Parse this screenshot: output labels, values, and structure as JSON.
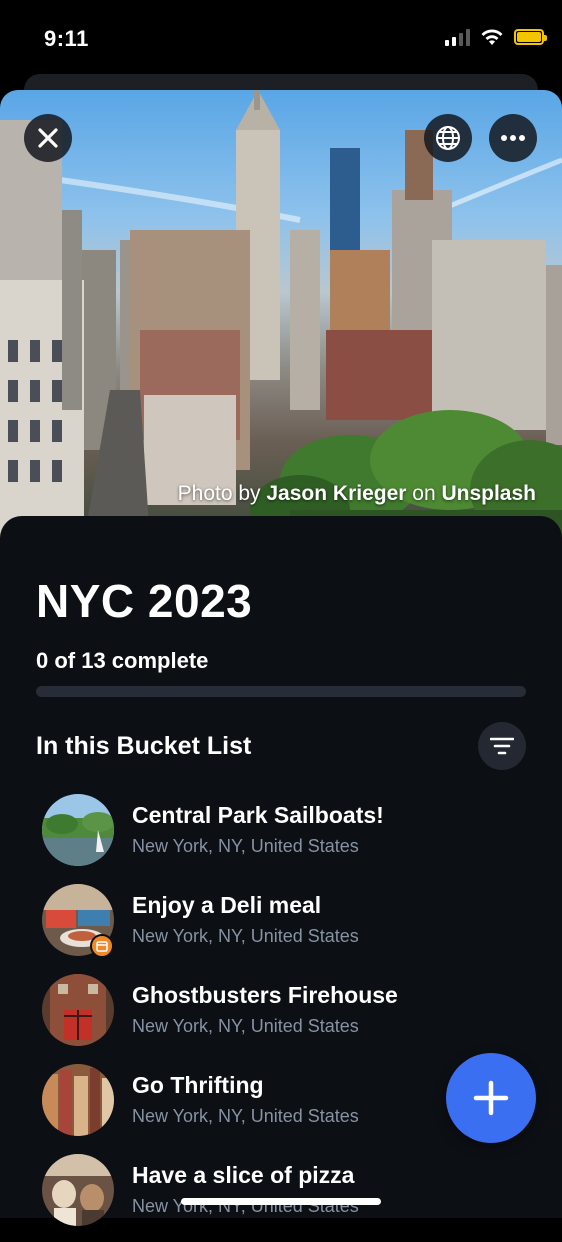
{
  "status_bar": {
    "time": "9:11"
  },
  "hero": {
    "credit_prefix": "Photo by ",
    "credit_author": "Jason Krieger",
    "credit_mid": " on ",
    "credit_source": "Unsplash",
    "close_icon": "close-icon",
    "globe_icon": "globe-icon",
    "more_icon": "more-icon"
  },
  "list_header": {
    "title": "NYC 2023",
    "progress_text": "0 of 13 complete",
    "progress_fraction": 0,
    "section_title": "In this Bucket List",
    "filter_icon": "filter-icon"
  },
  "items": [
    {
      "title": "Central Park Sailboats!",
      "location": "New York, NY, United States",
      "has_badge": false
    },
    {
      "title": "Enjoy a Deli meal",
      "location": "New York, NY, United States",
      "has_badge": true
    },
    {
      "title": "Ghostbusters Firehouse",
      "location": "New York, NY, United States",
      "has_badge": false
    },
    {
      "title": "Go Thrifting",
      "location": "New York, NY, United States",
      "has_badge": false
    },
    {
      "title": "Have a slice of pizza",
      "location": "New York, NY, United States",
      "has_badge": false
    }
  ],
  "fab": {
    "icon": "plus-icon"
  },
  "colors": {
    "accent": "#3b6ff2",
    "background": "#0c0f14",
    "subtitle": "#8792a3",
    "badge": "#f08a28"
  }
}
